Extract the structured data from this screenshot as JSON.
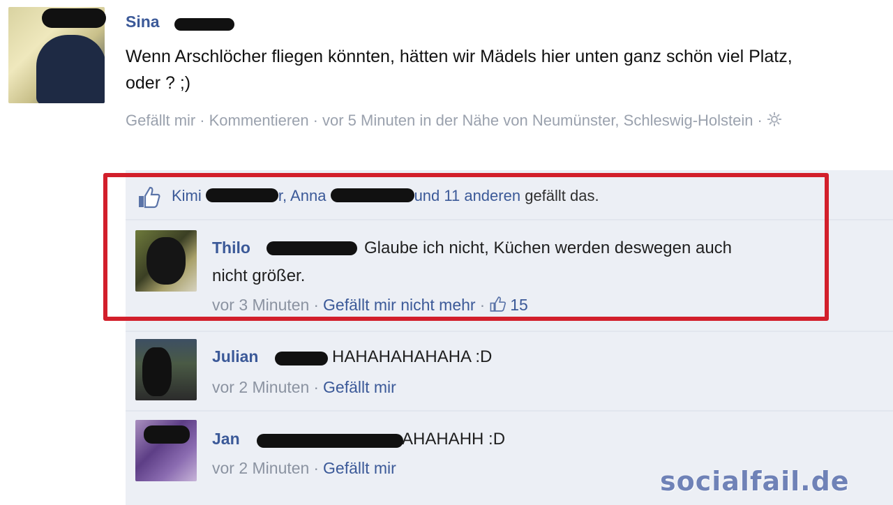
{
  "post": {
    "author": "Sina",
    "text": "Wenn Arschlöcher fliegen könnten, hätten wir Mädels hier unten ganz schön viel Platz, oder ? ;)",
    "meta": {
      "like": "Gefällt mir",
      "comment": "Kommentieren",
      "time": "vor 5 Minuten in der Nähe von Neumünster, Schleswig-Holstein",
      "icon": "settings-gear-icon"
    }
  },
  "likes": {
    "name1": "Kimi",
    "suffix1": "r,",
    "name2": "Anna",
    "others": "und 11 anderen",
    "tail": "gefällt das.",
    "icon": "thumbs-up-icon"
  },
  "comments": [
    {
      "author": "Thilo",
      "text_line1": "Glaube ich nicht, Küchen werden deswegen auch",
      "text_line2": "nicht größer.",
      "time": "vor 3 Minuten",
      "action": "Gefällt mir nicht mehr",
      "like_count": "15"
    },
    {
      "author": "Julian",
      "text": "HAHAHAHAHAHA :D",
      "time": "vor 2 Minuten",
      "action": "Gefällt mir"
    },
    {
      "author": "Jan",
      "text": "AHAHAHH :D",
      "time": "vor 2 Minuten",
      "action": "Gefällt mir"
    }
  ],
  "watermark": "socialfail.de",
  "colors": {
    "link": "#3b5998",
    "highlight": "#d21f2b",
    "comment_bg": "#eceff5"
  }
}
